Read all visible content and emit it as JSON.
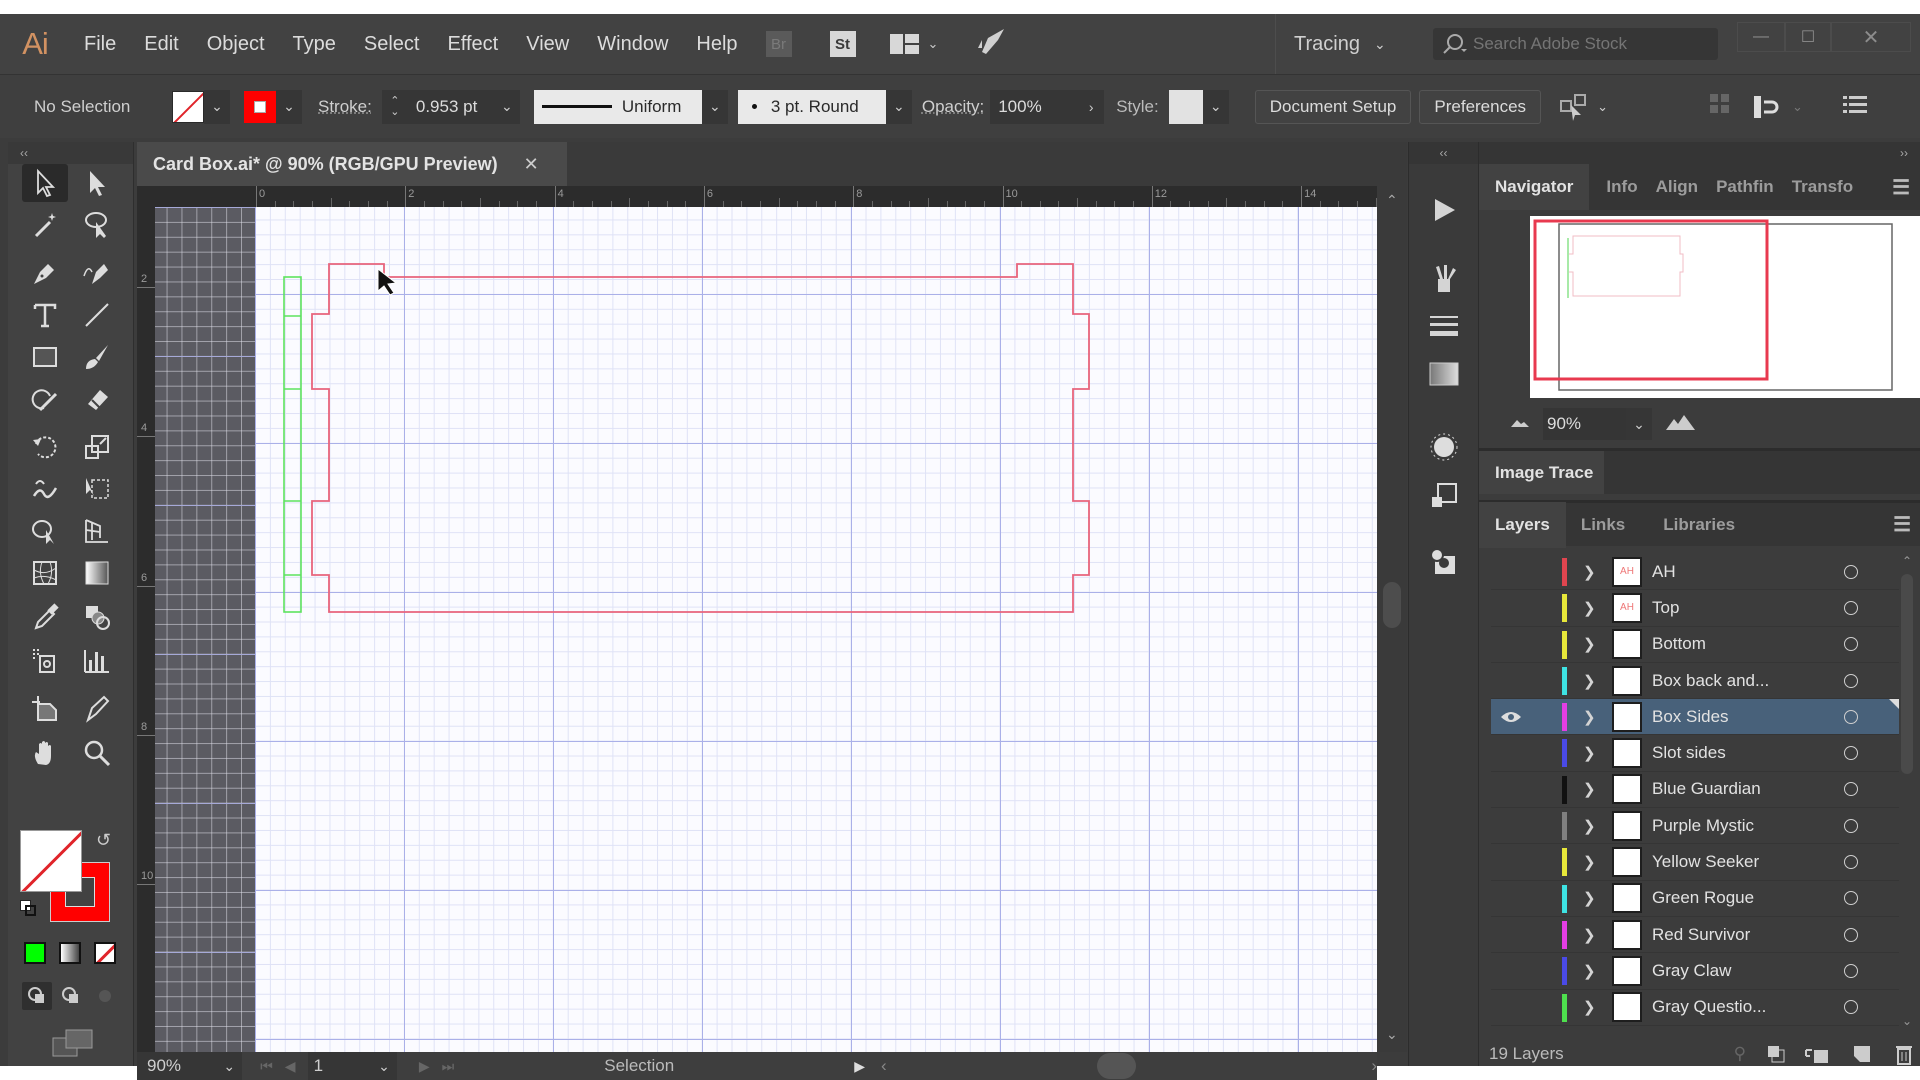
{
  "app": {
    "logo": "Ai",
    "menu": [
      "File",
      "Edit",
      "Object",
      "Type",
      "Select",
      "Effect",
      "View",
      "Window",
      "Help"
    ],
    "bridge_badge": "Br",
    "stock_badge": "St",
    "workspace": "Tracing",
    "stock_search_placeholder": "Search Adobe Stock",
    "window_controls": {
      "minimize": "—",
      "maximize": "☐",
      "close": "✕"
    }
  },
  "control_bar": {
    "selection_status": "No Selection",
    "stroke_label": "Stroke:",
    "stroke_weight": "0.953 pt",
    "variable_width_profile": "Uniform",
    "brush": "3 pt. Round",
    "opacity_label": "Opacity:",
    "opacity": "100%",
    "style_label": "Style:",
    "document_setup": "Document Setup",
    "preferences": "Preferences",
    "colors": {
      "fill": "none",
      "stroke": "#ff0000"
    }
  },
  "document": {
    "tab_title": "Card Box.ai* @ 90% (RGB/GPU Preview)",
    "close": "✕",
    "ruler_h_labels": [
      "0",
      "2",
      "4",
      "6",
      "8",
      "10",
      "12",
      "14"
    ],
    "ruler_v_labels": [
      "2",
      "4",
      "6",
      "8",
      "10"
    ]
  },
  "tools": [
    "selection-tool",
    "direct-selection-tool",
    "magic-wand-tool",
    "lasso-tool",
    "pen-tool",
    "curvature-tool",
    "type-tool",
    "line-segment-tool",
    "rectangle-tool",
    "paintbrush-tool",
    "shaper-tool",
    "eraser-tool",
    "rotate-tool",
    "scale-tool",
    "warp-tool",
    "free-transform-tool",
    "shape-builder-tool",
    "perspective-grid-tool",
    "mesh-tool",
    "gradient-tool",
    "eyedropper-tool",
    "blend-tool",
    "symbol-sprayer-tool",
    "column-graph-tool",
    "artboard-tool",
    "slice-tool",
    "hand-tool",
    "zoom-tool"
  ],
  "artwork": {
    "box_sides_color": "#e8647c",
    "box_back_color": "#5ee35e"
  },
  "status_bar": {
    "zoom": "90%",
    "artboard_number": "1",
    "current_tool": "Selection"
  },
  "navigator": {
    "tabs": [
      "Navigator",
      "Info",
      "Align",
      "Pathfin",
      "Transfo"
    ],
    "zoom": "90%"
  },
  "image_trace": {
    "title": "Image Trace"
  },
  "layers_panel": {
    "tabs": [
      "Layers",
      "Links",
      "Libraries"
    ],
    "count_label": "19 Layers",
    "layers": [
      {
        "name": "AH",
        "color": "#e0454f",
        "thumb": "AH",
        "visible": false,
        "selected": false
      },
      {
        "name": "Top",
        "color": "#e8e83a",
        "thumb": "AH",
        "visible": false,
        "selected": false
      },
      {
        "name": "Bottom",
        "color": "#e8e83a",
        "thumb": "",
        "visible": false,
        "selected": false
      },
      {
        "name": "Box back and...",
        "color": "#3ee3e3",
        "thumb": "",
        "visible": false,
        "selected": false
      },
      {
        "name": "Box Sides",
        "color": "#e43ee4",
        "thumb": "",
        "visible": true,
        "selected": true
      },
      {
        "name": "Slot sides",
        "color": "#4a4ae6",
        "thumb": "",
        "visible": false,
        "selected": false
      },
      {
        "name": "Blue Guardian",
        "color": "#111111",
        "thumb": "",
        "visible": false,
        "selected": false
      },
      {
        "name": "Purple Mystic",
        "color": "#808080",
        "thumb": "",
        "visible": false,
        "selected": false
      },
      {
        "name": "Yellow Seeker",
        "color": "#e8e83a",
        "thumb": "",
        "visible": false,
        "selected": false
      },
      {
        "name": "Green Rogue",
        "color": "#3ee3e3",
        "thumb": "",
        "visible": false,
        "selected": false
      },
      {
        "name": "Red Survivor",
        "color": "#e43ee4",
        "thumb": "",
        "visible": false,
        "selected": false
      },
      {
        "name": "Gray Claw",
        "color": "#4a4ae6",
        "thumb": "",
        "visible": false,
        "selected": false
      },
      {
        "name": "Gray Questio...",
        "color": "#4ee04e",
        "thumb": "",
        "visible": false,
        "selected": false
      }
    ]
  }
}
